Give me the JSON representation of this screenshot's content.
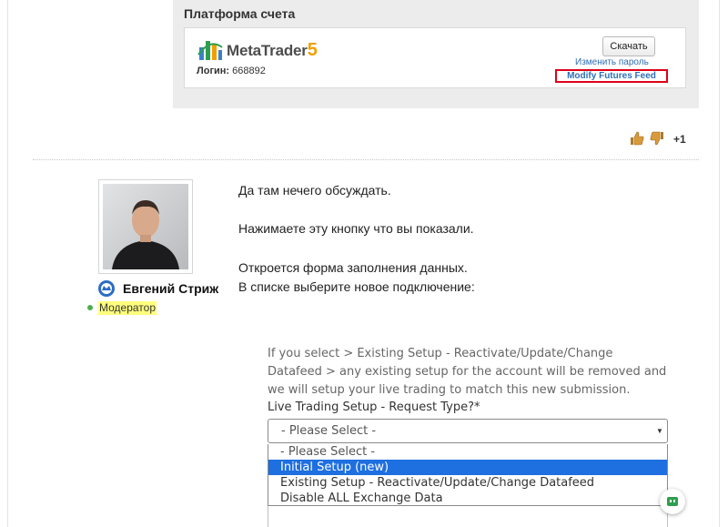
{
  "account_panel": {
    "title": "Платформа счета",
    "platform_name": "MetaTrader",
    "platform_version": "5",
    "login_label": "Логин:",
    "login_value": "668892",
    "download_button": "Скачать",
    "change_password_link": "Изменить пароль",
    "modify_feed_link": "Modify Futures Feed"
  },
  "rating": {
    "score": "+1",
    "like_icon": "thumbs-up-icon",
    "dislike_icon": "thumbs-down-icon"
  },
  "author": {
    "name": "Евгений Стриж",
    "role": "Модератор",
    "status_color": "#4caf50",
    "role_highlight": "#ffff7e"
  },
  "post": {
    "lines": [
      "Да там нечего обсуждать.",
      "Нажимаете эту кнопку что вы показали.",
      "Откроется форма заполнения данных.",
      "В списке выберите новое подключение:"
    ]
  },
  "form": {
    "description": "If you select > Existing Setup - Reactivate/Update/Change Datafeed > any existing setup for the account will be removed and we will setup your live trading to match this new submission.",
    "label": "Live Trading Setup - Request Type?*",
    "select_value": "- Please Select -",
    "options": [
      "- Please Select -",
      "Initial Setup (new)",
      "Existing Setup - Reactivate/Update/Change Datafeed",
      "Disable ALL Exchange Data"
    ],
    "selected_index": 1,
    "highlight_color": "#1e6fe0"
  }
}
